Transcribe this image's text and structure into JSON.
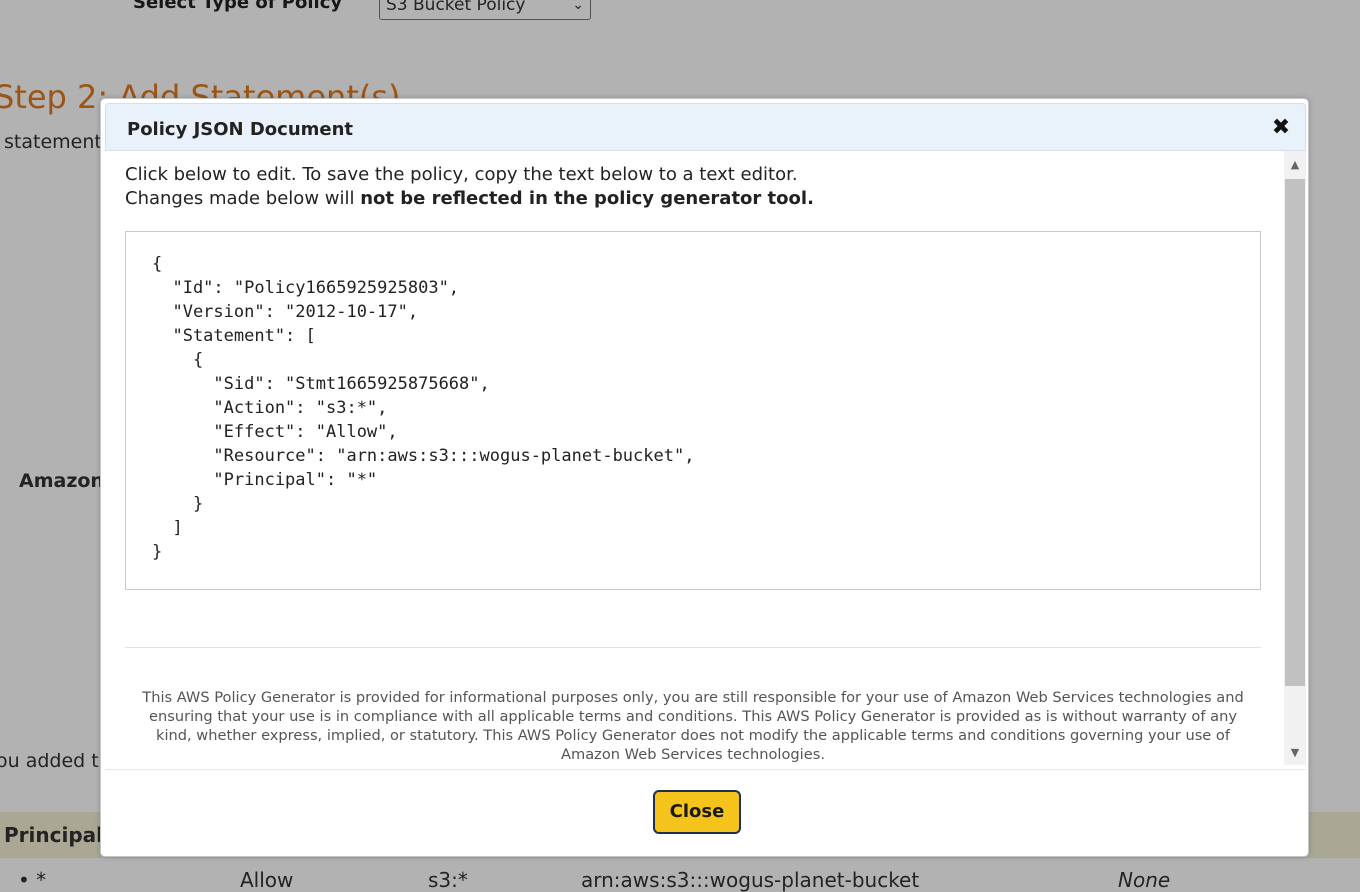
{
  "background": {
    "policy_type_label": "Select Type of Policy",
    "policy_type_value": "S3 Bucket Policy",
    "step2_heading": "Step 2: Add Statement(s)",
    "statement_text": "statement",
    "amazon_label": "Amazon",
    "added_text": "ou added t",
    "table": {
      "principal_header": "Principal",
      "row": {
        "principal": "• *",
        "effect": "Allow",
        "action": "s3:*",
        "resource": "arn:aws:s3:::wogus-planet-bucket",
        "conditions": "None"
      }
    }
  },
  "modal": {
    "title": "Policy JSON Document",
    "close_icon": "close-icon",
    "intro_line1": "Click below to edit. To save the policy, copy the text below to a text editor.",
    "intro_line2_prefix": "Changes made below will ",
    "intro_line2_bold": "not be reflected in the policy generator tool.",
    "policy_json": "{\n  \"Id\": \"Policy1665925925803\",\n  \"Version\": \"2012-10-17\",\n  \"Statement\": [\n    {\n      \"Sid\": \"Stmt1665925875668\",\n      \"Action\": \"s3:*\",\n      \"Effect\": \"Allow\",\n      \"Resource\": \"arn:aws:s3:::wogus-planet-bucket\",\n      \"Principal\": \"*\"\n    }\n  ]\n}",
    "disclaimer": "This AWS Policy Generator is provided for informational purposes only, you are still responsible for your use of Amazon Web Services technologies and ensuring that your use is in compliance with all applicable terms and conditions. This AWS Policy Generator is provided as is without warranty of any kind, whether express, implied, or statutory. This AWS Policy Generator does not modify the applicable terms and conditions governing your use of Amazon Web Services technologies.",
    "close_button_label": "Close"
  },
  "colors": {
    "step_heading": "#e07a1f",
    "header_bg": "#e9f1fb",
    "close_button_bg": "#f4c31c",
    "close_button_border": "#1f2f4e",
    "table_header_bg": "#f4efd6"
  }
}
